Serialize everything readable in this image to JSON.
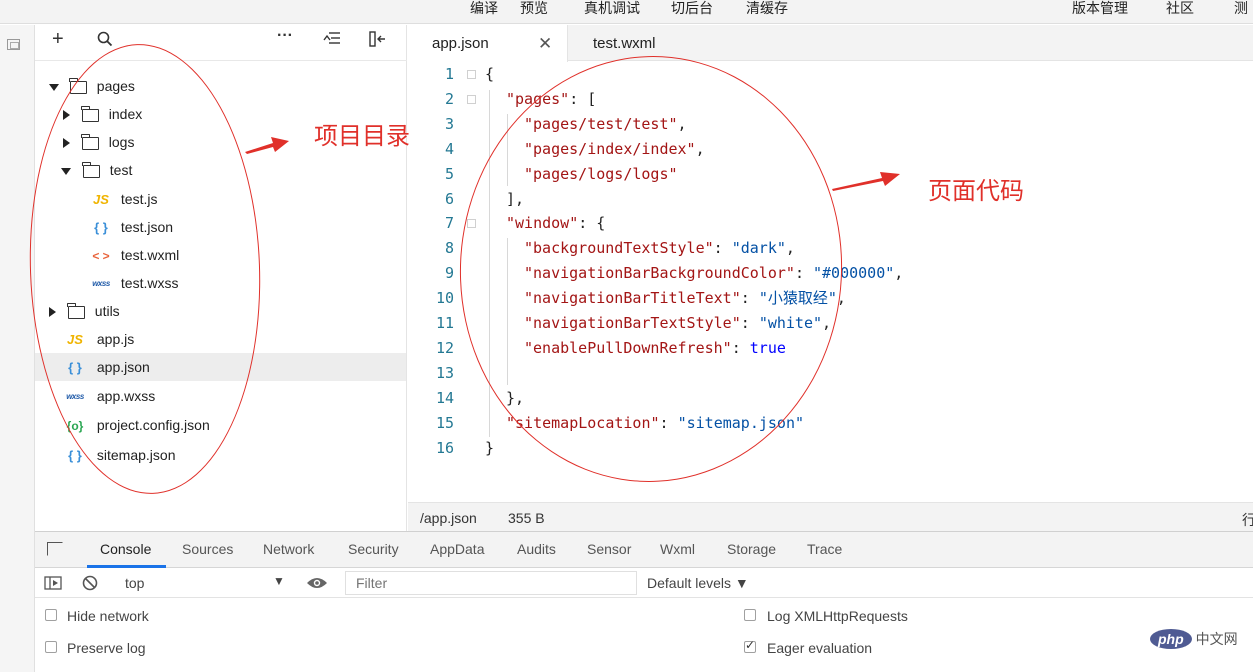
{
  "topbar": {
    "items": [
      "编译",
      "预览",
      "真机调试",
      "切后台",
      "清缓存"
    ],
    "right_items": [
      "版本管理",
      "社区",
      "测"
    ]
  },
  "explorer": {
    "toolbar_icons": [
      "add-icon",
      "search-icon",
      "more-icon",
      "collapse-icon",
      "split-icon"
    ],
    "tree": [
      {
        "label": "pages",
        "type": "folder",
        "expanded": true
      },
      {
        "label": "index",
        "type": "folder",
        "expanded": false
      },
      {
        "label": "logs",
        "type": "folder",
        "expanded": false
      },
      {
        "label": "test",
        "type": "folder",
        "expanded": true
      },
      {
        "label": "test.js",
        "type": "js"
      },
      {
        "label": "test.json",
        "type": "json"
      },
      {
        "label": "test.wxml",
        "type": "wxml"
      },
      {
        "label": "test.wxss",
        "type": "wxss"
      },
      {
        "label": "utils",
        "type": "folder",
        "expanded": false
      },
      {
        "label": "app.js",
        "type": "js"
      },
      {
        "label": "app.json",
        "type": "json",
        "selected": true
      },
      {
        "label": "app.wxss",
        "type": "wxss"
      },
      {
        "label": "project.config.json",
        "type": "config"
      },
      {
        "label": "sitemap.json",
        "type": "json"
      }
    ],
    "icon_glyphs": {
      "js": "JS",
      "json": "{ }",
      "wxml": "< >",
      "wxss": "wxss",
      "config": "{o}"
    }
  },
  "editor": {
    "tabs": [
      {
        "label": "app.json",
        "active": true
      },
      {
        "label": "test.wxml",
        "active": false
      }
    ],
    "close_glyph": "✕",
    "line_numbers": [
      "1",
      "2",
      "3",
      "4",
      "5",
      "6",
      "7",
      "8",
      "9",
      "10",
      "11",
      "12",
      "13",
      "14",
      "15",
      "16"
    ],
    "code": {
      "l1": "{",
      "l2_key": "\"pages\"",
      "l2_rest": ": [",
      "l3": "\"pages/test/test\"",
      "l3_rest": ",",
      "l4": "\"pages/index/index\"",
      "l4_rest": ",",
      "l5": "\"pages/logs/logs\"",
      "l6": "],",
      "l7_key": "\"window\"",
      "l7_rest": ": {",
      "l8_key": "\"backgroundTextStyle\"",
      "l8_val": "\"dark\"",
      "l9_key": "\"navigationBarBackgroundColor\"",
      "l9_val": "\"#000000\"",
      "l10_key": "\"navigationBarTitleText\"",
      "l10_val": "\"小猿取经\"",
      "l11_key": "\"navigationBarTextStyle\"",
      "l11_val": "\"white\"",
      "l12_key": "\"enablePullDownRefresh\"",
      "l12_val": "true",
      "l14": "},",
      "l15_key": "\"sitemapLocation\"",
      "l15_val": "\"sitemap.json\"",
      "l16": "}",
      "colon": ": ",
      "comma": ","
    },
    "status": {
      "path": "/app.json",
      "size": "355 B",
      "right": "行"
    }
  },
  "annotations": {
    "left_label": "项目目录",
    "right_label": "页面代码",
    "color": "#e0302a"
  },
  "devtools": {
    "tabs": [
      "Console",
      "Sources",
      "Network",
      "Security",
      "AppData",
      "Audits",
      "Sensor",
      "Wxml",
      "Storage",
      "Trace"
    ],
    "active_tab": "Console",
    "context": "top",
    "filter_placeholder": "Filter",
    "levels": "Default levels ▼",
    "options": {
      "hide_network": {
        "label": "Hide network",
        "checked": false
      },
      "preserve_log": {
        "label": "Preserve log",
        "checked": false
      },
      "log_xhr": {
        "label": "Log XMLHttpRequests",
        "checked": false
      },
      "eager_eval": {
        "label": "Eager evaluation",
        "checked": true
      }
    }
  },
  "watermark": {
    "text": "php",
    "suffix": "中文网"
  }
}
